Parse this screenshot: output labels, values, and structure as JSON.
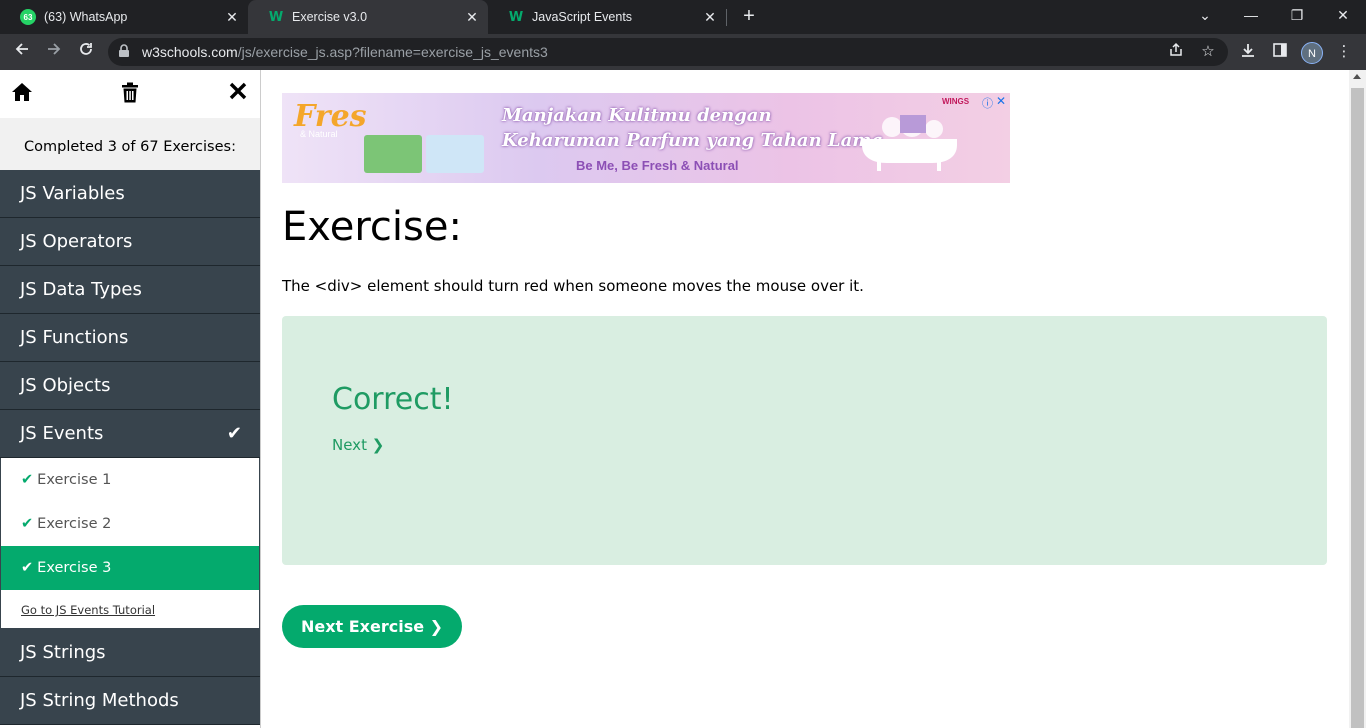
{
  "browser": {
    "tabs": [
      {
        "title": "(63) WhatsApp",
        "favicon_text": "63",
        "active": false
      },
      {
        "title": "Exercise v3.0",
        "favicon_text": "W",
        "active": true
      },
      {
        "title": "JavaScript Events",
        "favicon_text": "W",
        "active": false
      }
    ],
    "new_tab": "+",
    "window_controls": {
      "minimize": "—",
      "restore": "❐",
      "close": "✕",
      "tab_search": "⌄"
    },
    "url_host": "w3schools.com",
    "url_path": "/js/exercise_js.asp?filename=exercise_js_events3",
    "profile_initial": "N"
  },
  "sidebar": {
    "completed_text": "Completed 3 of 67 Exercises:",
    "categories_before": [
      "JS Variables",
      "JS Operators",
      "JS Data Types",
      "JS Functions",
      "JS Objects"
    ],
    "active_category": "JS Events",
    "exercises": [
      "Exercise 1",
      "Exercise 2",
      "Exercise 3"
    ],
    "tutorial_link": "Go to JS Events Tutorial",
    "categories_after": [
      "JS Strings",
      "JS String Methods"
    ]
  },
  "ad": {
    "brand": "Fres",
    "brand_sub": "& Natural",
    "line1": "Manjakan Kulitmu dengan",
    "line2": "Keharuman Parfum yang Tahan Lama",
    "line3": "Be Me, Be Fresh & Natural",
    "wings": "WINGS"
  },
  "main": {
    "title": "Exercise:",
    "instruction": "The <div> element should turn red when someone moves the mouse over it.",
    "result_heading": "Correct!",
    "next_link": "Next ❯",
    "next_exercise_button": "Next Exercise ❯"
  },
  "colors": {
    "accent": "#04aa6d",
    "sidebar_dark": "#38444d",
    "result_bg": "#d9eee1",
    "result_text": "#1f9b63"
  }
}
